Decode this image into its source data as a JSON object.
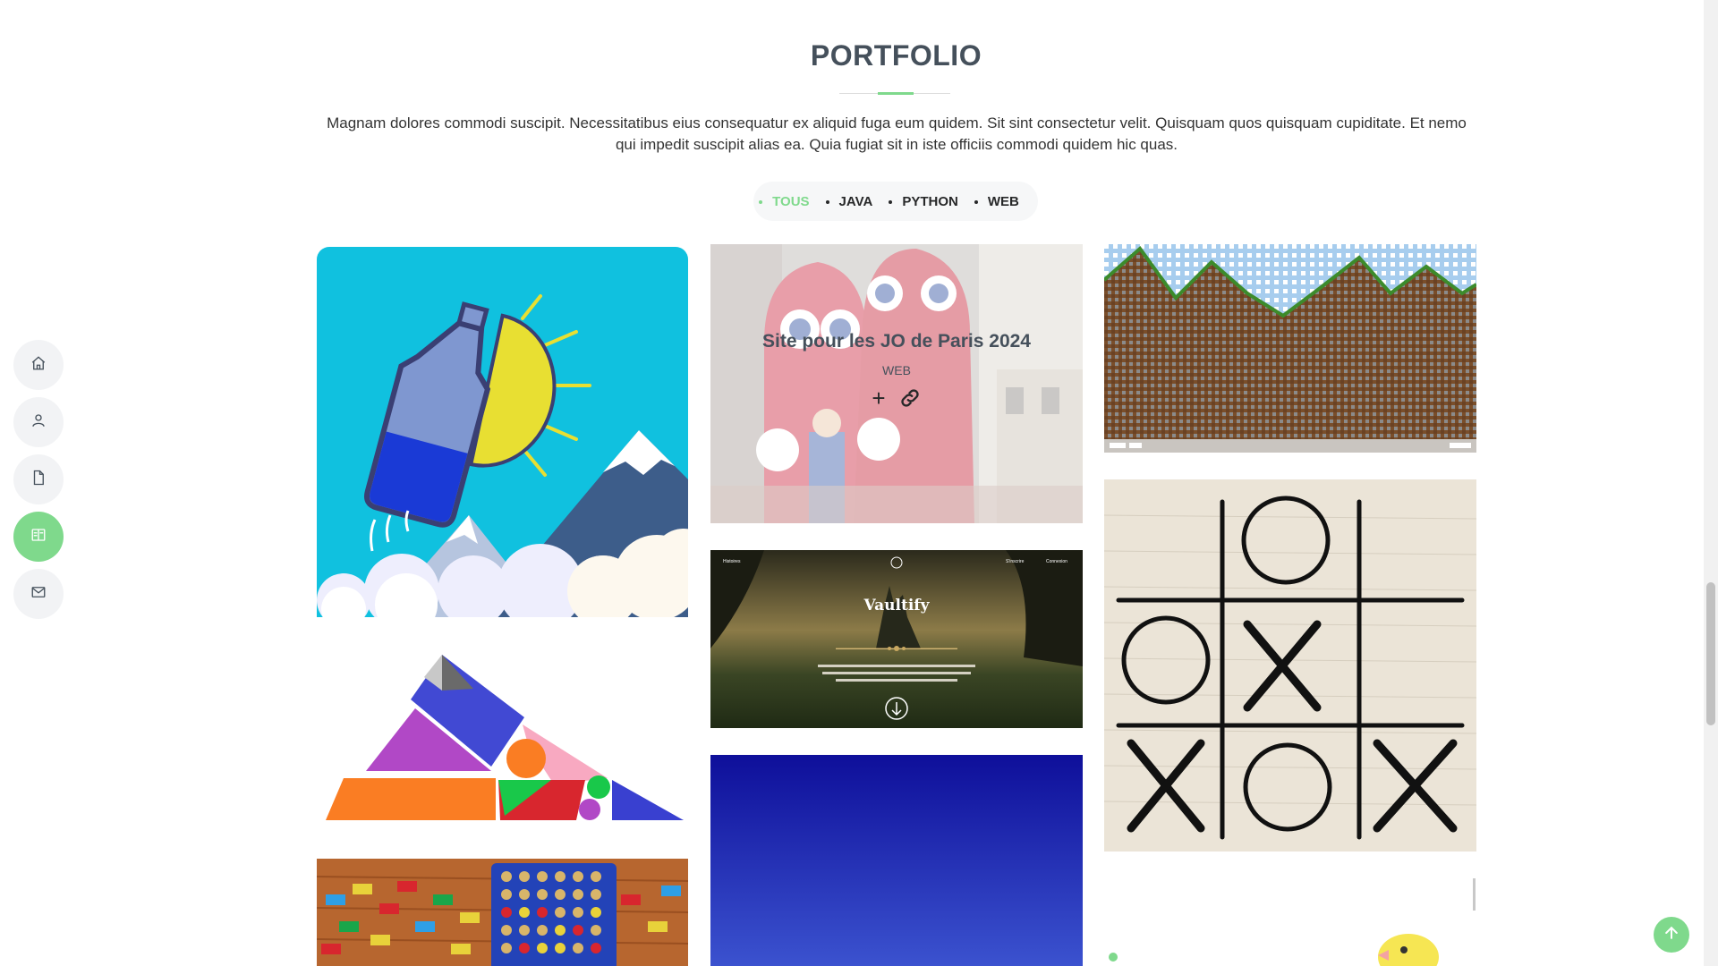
{
  "nav": {
    "items": [
      {
        "icon": "home-icon",
        "active": false
      },
      {
        "icon": "person-icon",
        "active": false
      },
      {
        "icon": "file-icon",
        "active": false
      },
      {
        "icon": "portfolio-icon",
        "active": true
      },
      {
        "icon": "envelope-icon",
        "active": false
      }
    ]
  },
  "section": {
    "title": "PORTFOLIO",
    "description": "Magnam dolores commodi suscipit. Necessitatibus eius consequatur ex aliquid fuga eum quidem. Sit sint consectetur velit. Quisquam quos quisquam cupiditate. Et nemo qui impedit suscipit alias ea. Quia fugiat sit in iste officiis commodi quidem hic quas."
  },
  "filters": [
    "TOUS",
    "JAVA",
    "PYTHON",
    "WEB"
  ],
  "active_filter": "TOUS",
  "portfolio": {
    "hovered": {
      "title": "Site pour les JO de Paris 2024",
      "category": "WEB",
      "details_icon": "+",
      "link_icon": "link-icon"
    },
    "vaultify": {
      "logo": "Vaultify",
      "nav_left": "Histoires",
      "nav_right_1": "S'inscrire",
      "nav_right_2": "Connexion"
    }
  },
  "colors": {
    "accent": "#7fd98c",
    "title": "#45505b"
  }
}
